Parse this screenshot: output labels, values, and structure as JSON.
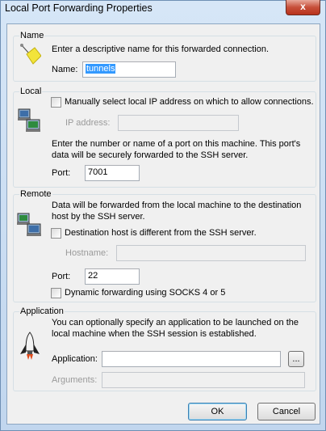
{
  "window": {
    "title": "Local Port Forwarding Properties",
    "close_glyph": "x"
  },
  "name_group": {
    "title": "Name",
    "description": "Enter a descriptive name for this forwarded connection.",
    "name_label": "Name:",
    "name_value": "tunnels"
  },
  "local_group": {
    "title": "Local",
    "manual_ip_label": "Manually select local IP address on which to allow connections.",
    "ip_label": "IP address:",
    "port_desc_line1": "Enter the number or name of a port on this machine.  This port's",
    "port_desc_line2": "data will be securely forwarded to the SSH server.",
    "port_label": "Port:",
    "port_value": "7001"
  },
  "remote_group": {
    "title": "Remote",
    "desc_line1": "Data will be forwarded from the local machine to the destination",
    "desc_line2": "host by the SSH server.",
    "dest_diff_label": "Destination host is different from the SSH server.",
    "hostname_label": "Hostname:",
    "port_label": "Port:",
    "port_value": "22",
    "socks_label": "Dynamic forwarding using SOCKS 4 or 5"
  },
  "application_group": {
    "title": "Application",
    "desc_line1": "You can optionally specify an application to be launched on the",
    "desc_line2": "local machine when the SSH session is established.",
    "app_label": "Application:",
    "app_value": "",
    "browse_label": "...",
    "args_label": "Arguments:",
    "args_value": ""
  },
  "buttons": {
    "ok": "OK",
    "cancel": "Cancel"
  }
}
